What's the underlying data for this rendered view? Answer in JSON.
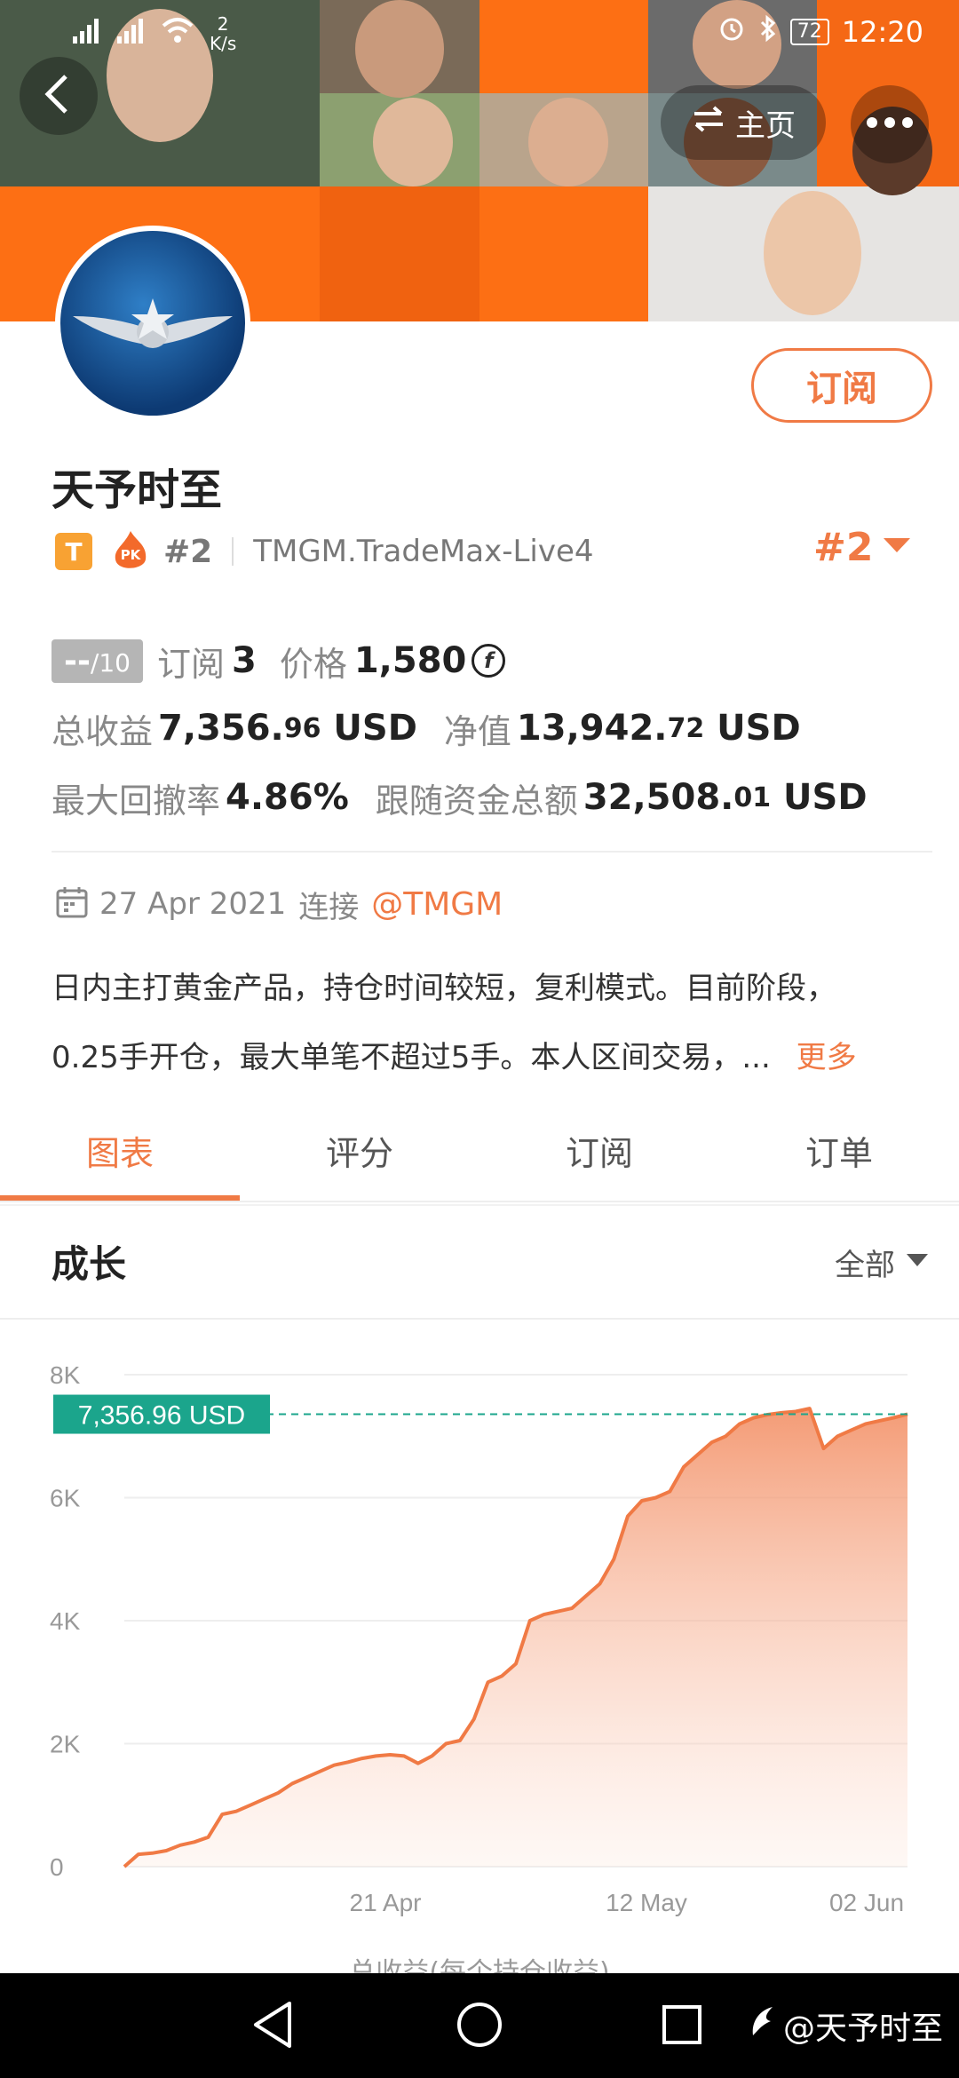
{
  "status_bar": {
    "net_speed_value": "2",
    "net_speed_unit": "K/s",
    "battery": "72",
    "time": "12:20"
  },
  "header": {
    "home_label": "主页"
  },
  "profile": {
    "name": "天予时至",
    "subscribe_label": "订阅",
    "badge_t": "T",
    "pk_label": "PK",
    "rank": "#2",
    "server": "TMGM.TradeMax-Live4",
    "rank_right": "#2"
  },
  "stats": {
    "score": "--",
    "score_max": "/10",
    "subscriptions_label": "订阅",
    "subscriptions": "3",
    "price_label": "价格",
    "price": "1,580",
    "coin_symbol": "f",
    "total_profit_label": "总收益",
    "total_profit_int": "7,356.",
    "total_profit_dec": "96",
    "total_profit_unit": " USD",
    "equity_label": "净值",
    "equity_int": "13,942.",
    "equity_dec": "72",
    "equity_unit": " USD",
    "drawdown_label": "最大回撤率",
    "drawdown": "4.86%",
    "follow_label": "跟随资金总额",
    "follow_int": "32,508.",
    "follow_dec": "01",
    "follow_unit": " USD"
  },
  "connect": {
    "date": "27 Apr 2021",
    "connect_label": "连接",
    "broker": "@TMGM"
  },
  "description": {
    "line1": "日内主打黄金产品，持仓时间较短，复利模式。目前阶段，",
    "line2": "0.25手开仓，最大单笔不超过5手。本人区间交易，...",
    "more": "更多"
  },
  "tabs": [
    "图表",
    "评分",
    "订阅",
    "订单"
  ],
  "growth": {
    "title": "成长",
    "filter": "全部",
    "partial_footer": "总收益(每个持仓收益)"
  },
  "nav": {
    "watermark": "@天予时至"
  },
  "colors": {
    "accent": "#f07a45",
    "teal": "#1ba58c",
    "banner_orange": "#fd6f14"
  },
  "chart_data": {
    "type": "area",
    "x_tick_labels": [
      "21 Apr",
      "12 May",
      "02 Jun"
    ],
    "y_tick_labels": [
      "0",
      "2K",
      "4K",
      "6K",
      "8K"
    ],
    "ylim": [
      0,
      8000
    ],
    "current_value_label": "7,356.96 USD",
    "current_value": 7356.96,
    "series": [
      {
        "values": [
          0,
          200,
          220,
          260,
          350,
          400,
          480,
          850,
          900,
          1000,
          1100,
          1200,
          1350,
          1450,
          1550,
          1650,
          1700,
          1760,
          1800,
          1820,
          1800,
          1680,
          1800,
          2000,
          2050,
          2400,
          3000,
          3100,
          3300,
          4000,
          4100,
          4150,
          4200,
          4400,
          4600,
          5000,
          5700,
          5950,
          6000,
          6100,
          6500,
          6700,
          6900,
          7000,
          7200,
          7300,
          7350,
          7380,
          7400,
          7450,
          6800,
          7000,
          7100,
          7200,
          7250,
          7300,
          7356.96
        ]
      }
    ]
  }
}
